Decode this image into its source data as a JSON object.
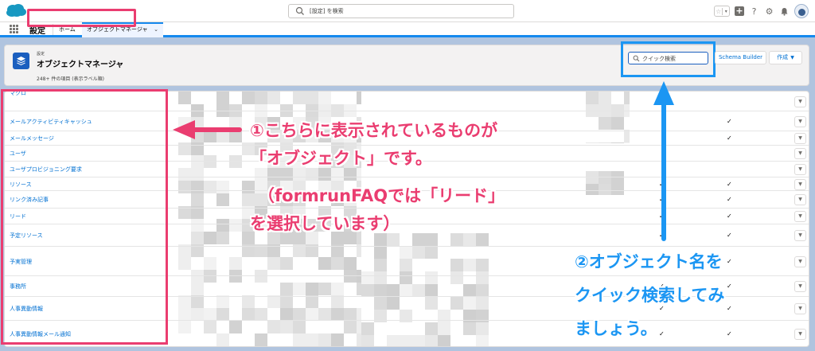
{
  "global_header": {
    "search_placeholder": "[設定] を検索"
  },
  "nav": {
    "app_name": "設定",
    "tabs": [
      {
        "label": "ホーム"
      },
      {
        "label": "オブジェクトマネージャ"
      }
    ]
  },
  "page_header": {
    "eyebrow": "設定",
    "title": "オブジェクトマネージャ",
    "item_count": "248+ 件の項目 (表示ラベル順)",
    "quick_search_placeholder": "クイック検索",
    "schema_builder_label": "Schema Builder",
    "create_label": "作成"
  },
  "objects": [
    {
      "label": "マクロ",
      "checks": []
    },
    {
      "label": "メールアクティビティキャッシュ",
      "checks": [
        "col3"
      ]
    },
    {
      "label": "メールメッセージ",
      "checks": [
        "col3"
      ]
    },
    {
      "label": "ユーザ",
      "checks": []
    },
    {
      "label": "ユーザプロビジョニング要求",
      "checks": []
    },
    {
      "label": "リソース",
      "checks": [
        "col2",
        "col3"
      ]
    },
    {
      "label": "リンク済み記事",
      "checks": [
        "col2",
        "col3"
      ]
    },
    {
      "label": "リード",
      "checks": [
        "col2",
        "col3"
      ]
    },
    {
      "label": "予定リソース",
      "checks": [
        "col2",
        "col3"
      ]
    },
    {
      "label": "予実管理",
      "checks": [
        "col2",
        "col3"
      ]
    },
    {
      "label": "事務所",
      "checks": [
        "col2",
        "col3"
      ]
    },
    {
      "label": "人事異動情報",
      "checks": [
        "col2",
        "col3"
      ]
    },
    {
      "label": "人事異動情報メール通知",
      "checks": [
        "col2",
        "col3"
      ]
    }
  ],
  "check_glyph": "✓",
  "dropdown_glyph": "▼",
  "annotations": {
    "pink_lines": [
      "①こちらに表示されているものが",
      "「オブジェクト」です。",
      "（formrunFAQでは「リード」",
      "を選択しています）"
    ],
    "blue_lines": [
      "②オブジェクト名を",
      "クイック検索してみ",
      "ましょう。"
    ]
  },
  "colors": {
    "pink": "#ea3d70",
    "blue": "#1b96f3",
    "link": "#0070d2",
    "brand": "#1589ee"
  }
}
